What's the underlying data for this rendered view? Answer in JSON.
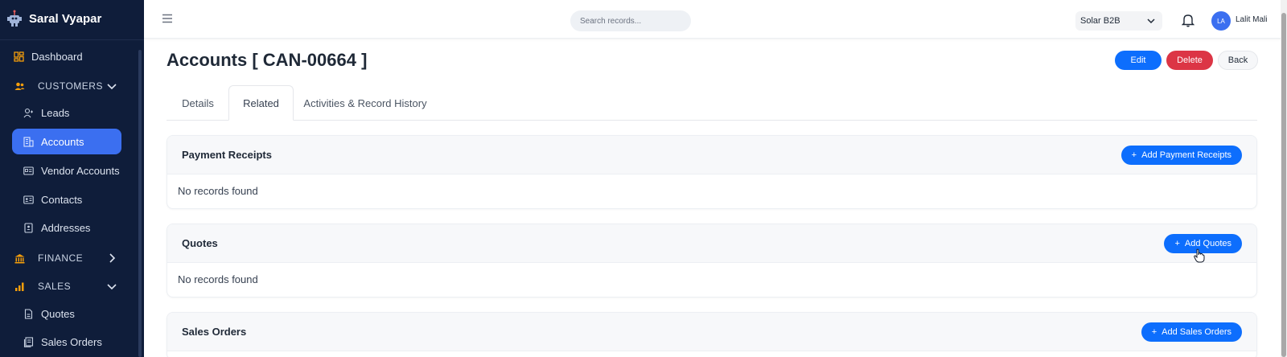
{
  "brand": {
    "name": "Saral Vyapar"
  },
  "sidebar": {
    "dashboard": "Dashboard",
    "customers_section": "CUSTOMERS",
    "leads": "Leads",
    "accounts": "Accounts",
    "vendor_accounts": "Vendor Accounts",
    "contacts": "Contacts",
    "addresses": "Addresses",
    "finance_section": "FINANCE",
    "sales_section": "SALES",
    "quotes": "Quotes",
    "sales_orders": "Sales Orders"
  },
  "topbar": {
    "search_placeholder": "Search records...",
    "org_selected": "Solar B2B",
    "avatar_initials": "LA",
    "user_name": "Lalit Mali"
  },
  "page": {
    "title": "Accounts [ CAN-00664 ]",
    "edit_label": "Edit",
    "delete_label": "Delete",
    "back_label": "Back"
  },
  "tabs": [
    "Details",
    "Related",
    "Activities & Record History"
  ],
  "related": {
    "payment_receipts": {
      "title": "Payment Receipts",
      "add_label": "Add Payment Receipts",
      "empty": "No records found"
    },
    "quotes": {
      "title": "Quotes",
      "add_label": "Add Quotes",
      "empty": "No records found"
    },
    "sales_orders": {
      "title": "Sales Orders",
      "add_label": "Add Sales Orders"
    }
  },
  "colors": {
    "sidebar_bg": "#0f1d3a",
    "active_item": "#3b6ff0",
    "primary": "#0d6efd",
    "danger": "#dc3545",
    "section_icon": "#f59e0b"
  }
}
